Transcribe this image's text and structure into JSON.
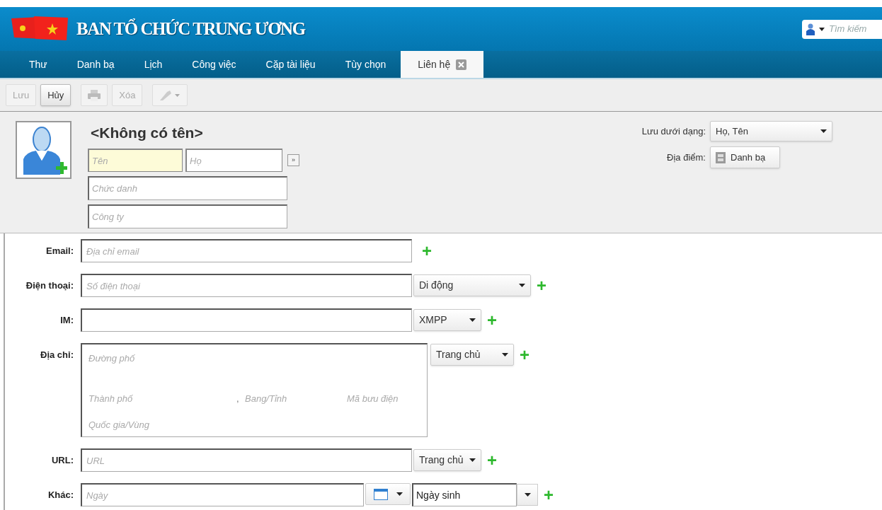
{
  "header": {
    "title": "BAN TỔ CHỨC TRUNG ƯƠNG",
    "search_placeholder": "Tìm kiếm"
  },
  "tabs": [
    {
      "label": "Thư",
      "selected": false,
      "closable": false
    },
    {
      "label": "Danh bạ",
      "selected": false,
      "closable": false
    },
    {
      "label": "Lịch",
      "selected": false,
      "closable": false
    },
    {
      "label": "Công việc",
      "selected": false,
      "closable": false
    },
    {
      "label": "Cặp tài liệu",
      "selected": false,
      "closable": false
    },
    {
      "label": "Tùy chọn",
      "selected": false,
      "closable": false
    },
    {
      "label": "Liên hệ",
      "selected": true,
      "closable": true
    }
  ],
  "toolbar": [
    {
      "kind": "text",
      "label": "Lưu",
      "disabled": true
    },
    {
      "kind": "text",
      "label": "Hủy",
      "disabled": false
    },
    {
      "kind": "print",
      "disabled": true
    },
    {
      "kind": "text",
      "label": "Xóa",
      "disabled": true
    },
    {
      "kind": "tag",
      "disabled": true
    }
  ],
  "contact": {
    "heading": "<Không có tên>",
    "first_name": {
      "placeholder": "Tên",
      "focused": true
    },
    "last_name": {
      "placeholder": "Họ",
      "focused": false
    },
    "more_button": "»",
    "job_title": {
      "placeholder": "Chức danh"
    },
    "company": {
      "placeholder": "Công ty"
    },
    "file_as": {
      "label": "Lưu dưới dạng:",
      "value": "Họ, Tên"
    },
    "location": {
      "label": "Địa điểm:",
      "value": "Danh bạ"
    }
  },
  "rows": [
    {
      "kind": "field",
      "label": "Email:",
      "placeholder": "Địa chỉ email",
      "add": "+"
    },
    {
      "kind": "field",
      "label": "Điện thoại:",
      "placeholder": "Số điện thoại",
      "type": "Di động",
      "add": "+"
    },
    {
      "kind": "field",
      "label": "IM:",
      "type": "XMPP",
      "add": "+"
    },
    {
      "kind": "address",
      "label": "Địa chỉ:",
      "street": "Đường phố",
      "city": "Thành phố",
      "separator": ",",
      "state": "Bang/Tỉnh",
      "zip": "Mã bưu điện",
      "country": "Quốc gia/Vùng",
      "type": "Trang chủ",
      "add": "+"
    },
    {
      "kind": "field",
      "label": "URL:",
      "placeholder": "URL",
      "type": "Trang chủ",
      "add": "+"
    },
    {
      "kind": "date",
      "label": "Khác:",
      "placeholder": "Ngày",
      "type": "Ngày sinh",
      "add": "+"
    }
  ]
}
